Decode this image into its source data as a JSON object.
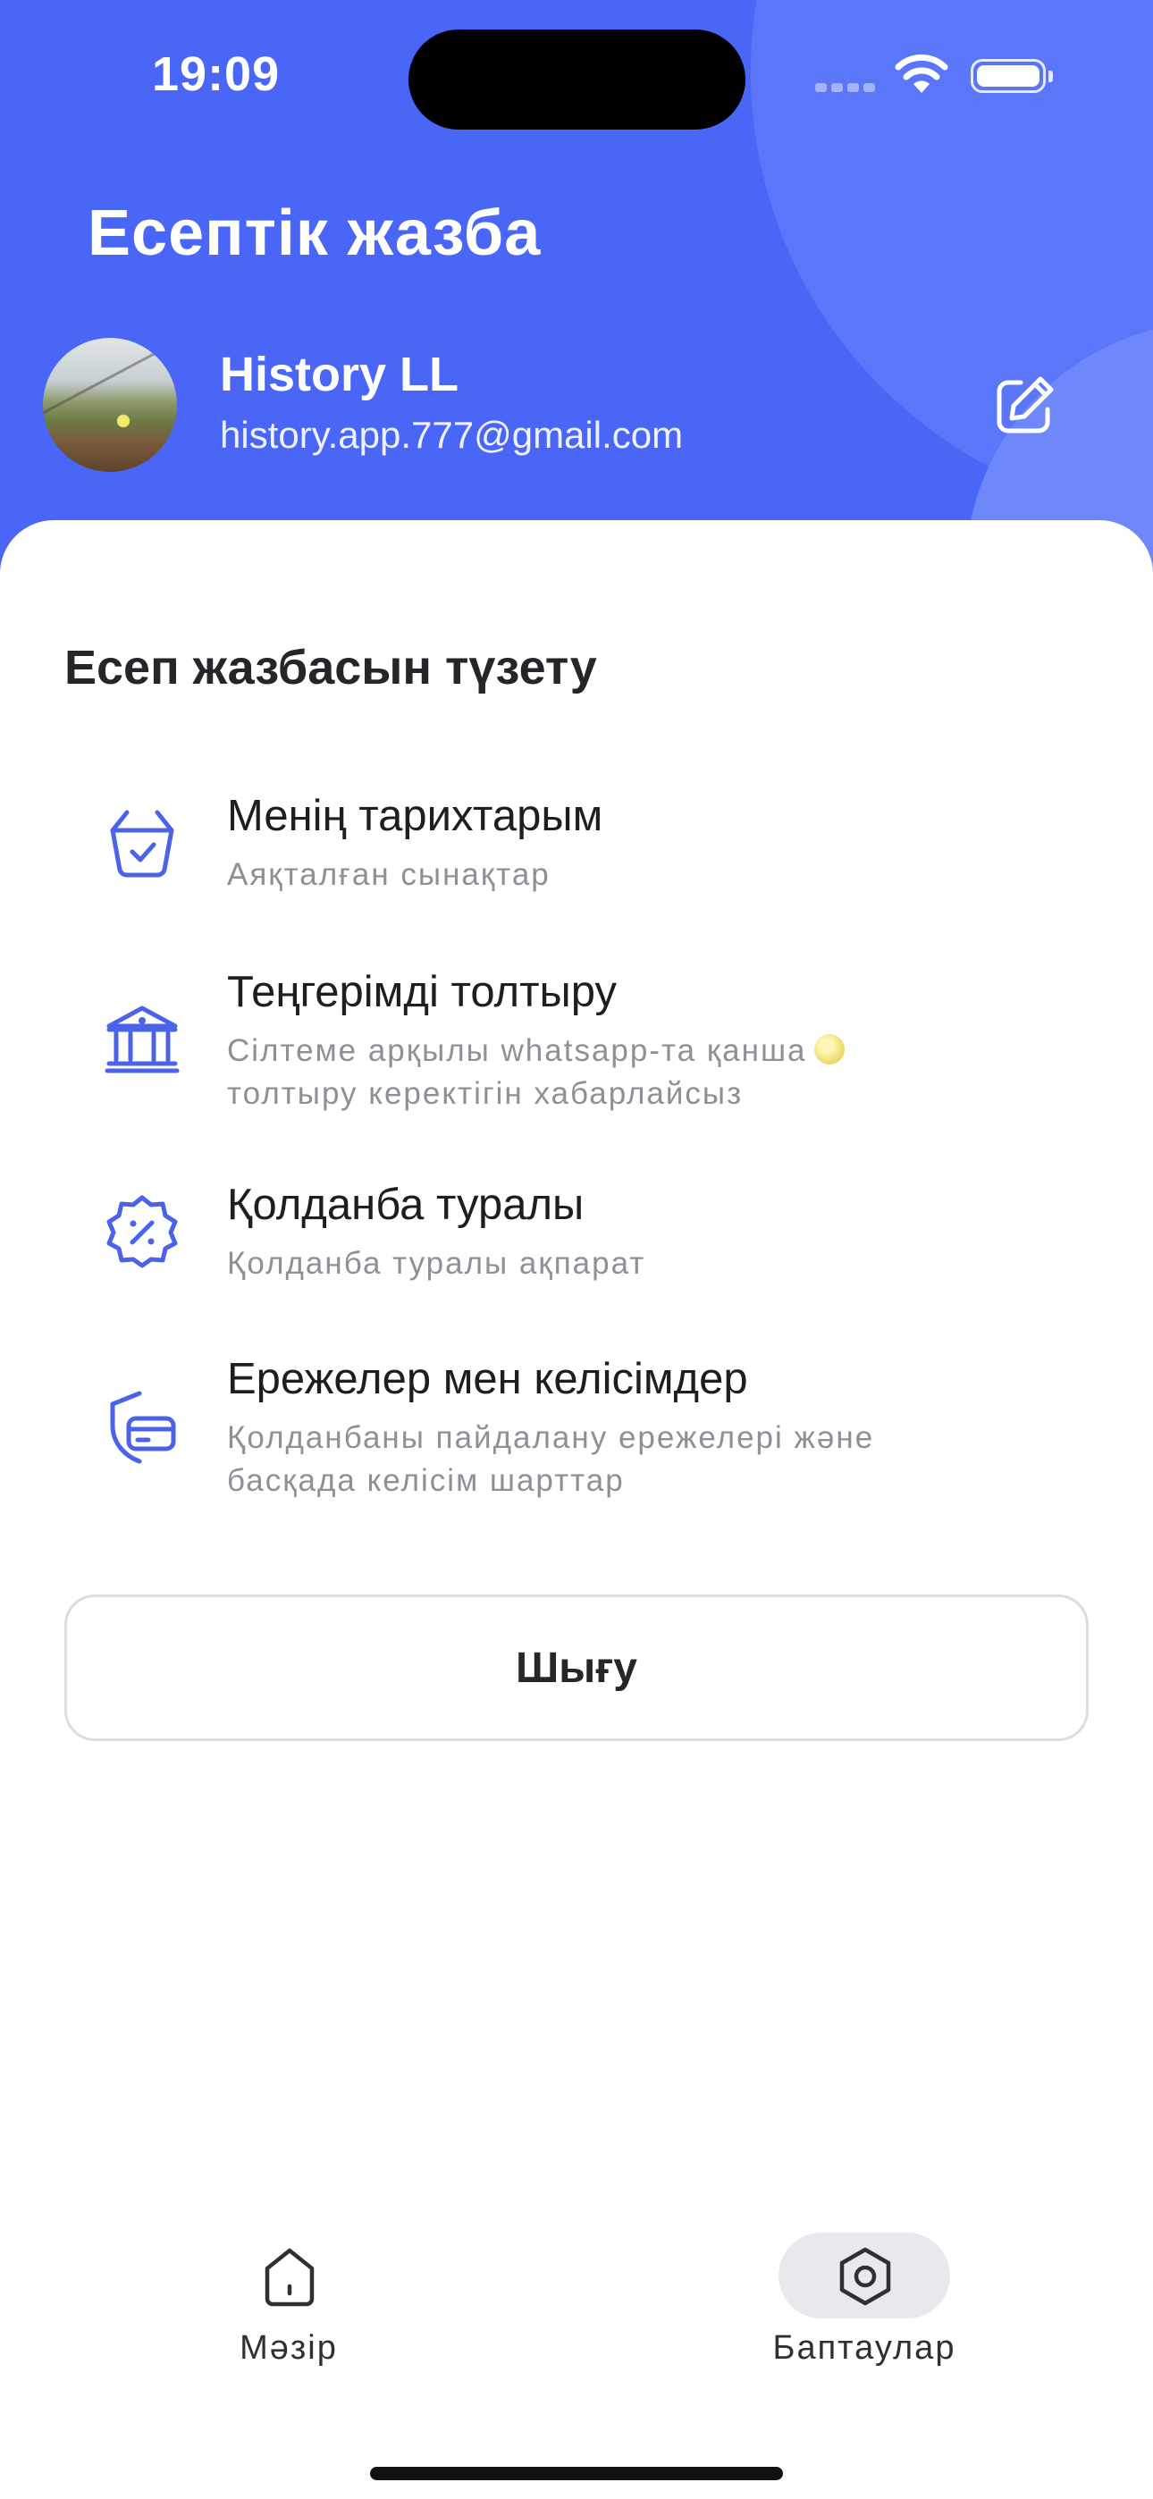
{
  "status_bar": {
    "time": "19:09"
  },
  "header": {
    "title": "Есептік жазба",
    "user_name": "History LL",
    "user_email": "history.app.777@gmail.com"
  },
  "section": {
    "title": "Есеп жазбасын түзету"
  },
  "menu": [
    {
      "icon": "basket-check-icon",
      "title": "Менің тарихтарым",
      "subtitle": "Аяқталған сынақтар"
    },
    {
      "icon": "bank-icon",
      "title": "Теңгерімді толтыру",
      "subtitle_line1": "Сілтеме арқылы whatsapp-та қанша",
      "subtitle_line2": "толтыру керектігін хабарлайсыз"
    },
    {
      "icon": "discount-badge-icon",
      "title": "Қолданба туралы",
      "subtitle": "Қолданба туралы ақпарат"
    },
    {
      "icon": "shield-card-icon",
      "title": "Ережелер мен келісімдер",
      "subtitle_line1": "Қолданбаны пайдалану ережелері және",
      "subtitle_line2": "басқада келісім шарттар"
    }
  ],
  "logout_label": "Шығу",
  "tabs": [
    {
      "icon": "home-icon",
      "label": "Мәзір",
      "active": false
    },
    {
      "icon": "settings-hexagon-icon",
      "label": "Баптаулар",
      "active": true
    }
  ],
  "colors": {
    "accent": "#4a66f7",
    "icon_blue": "#4a63e8",
    "text_muted": "#8f9096"
  }
}
